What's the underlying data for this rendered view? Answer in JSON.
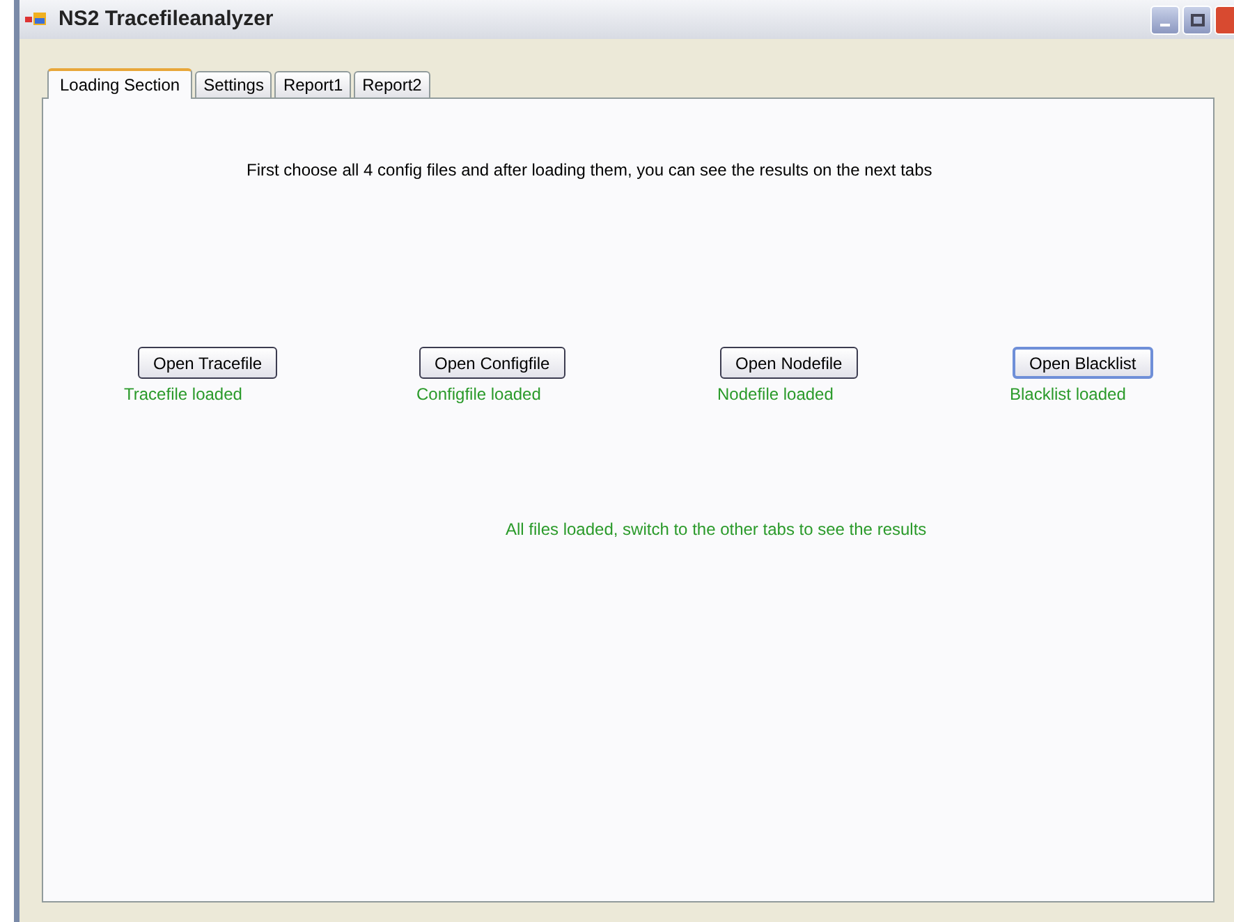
{
  "window": {
    "title": "NS2 Tracefileanalyzer"
  },
  "tabs": [
    {
      "label": "Loading Section",
      "selected": true
    },
    {
      "label": "Settings",
      "selected": false
    },
    {
      "label": "Report1",
      "selected": false
    },
    {
      "label": "Report2",
      "selected": false
    }
  ],
  "instructions": "First choose all 4 config files and after loading them, you can see the results on the next tabs",
  "loaders": [
    {
      "button": "Open Tracefile",
      "status": "Tracefile loaded",
      "focused": false
    },
    {
      "button": "Open Configfile",
      "status": "Configfile loaded",
      "focused": false
    },
    {
      "button": "Open Nodefile",
      "status": "Nodefile loaded",
      "focused": false
    },
    {
      "button": "Open Blacklist",
      "status": "Blacklist loaded",
      "focused": true
    }
  ],
  "summary": "All files loaded, switch to the other tabs to see the results"
}
